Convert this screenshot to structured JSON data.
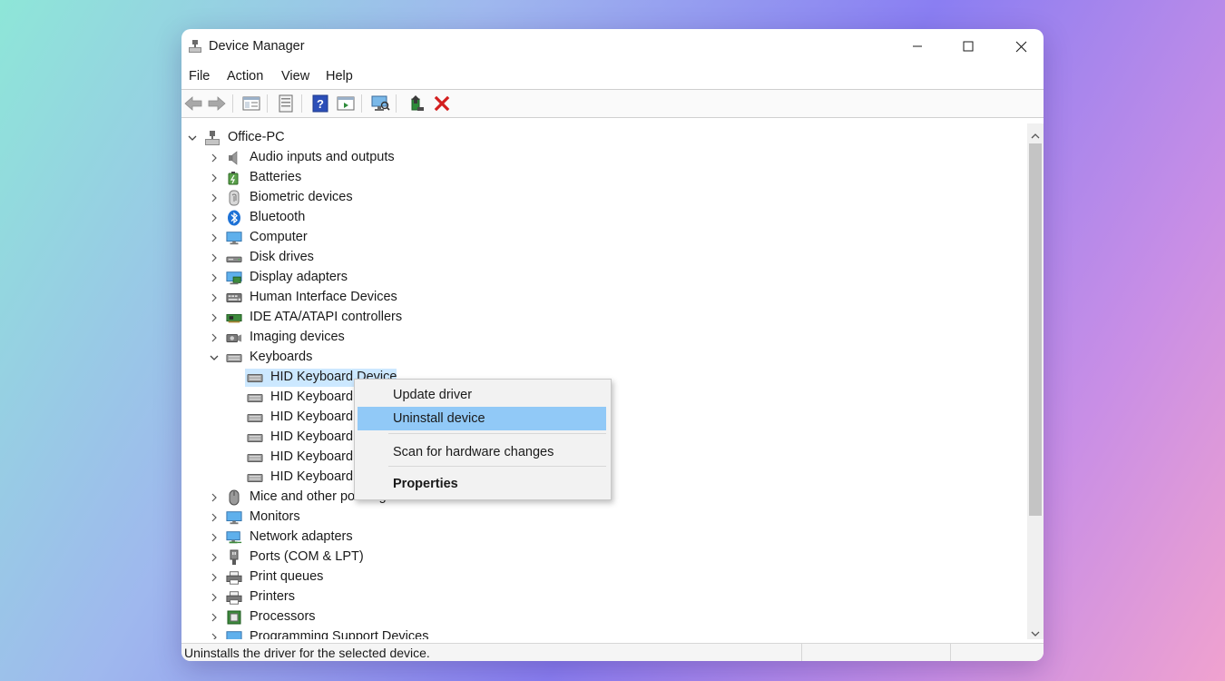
{
  "window": {
    "title": "Device Manager",
    "app_icon": "device-manager-icon"
  },
  "menubar": [
    "File",
    "Action",
    "View",
    "Help"
  ],
  "toolbar": {
    "icons": [
      "back-arrow-icon",
      "forward-arrow-icon",
      "show-hide-console-tree-icon",
      "properties-sheet-icon",
      "help-icon",
      "action-pane-icon",
      "scan-hardware-icon",
      "update-driver-icon",
      "uninstall-device-icon"
    ]
  },
  "tree": {
    "root": "Office-PC",
    "categories_top": [
      {
        "label": "Audio inputs and outputs",
        "icon": "speaker-icon"
      },
      {
        "label": "Batteries",
        "icon": "battery-icon"
      },
      {
        "label": "Biometric devices",
        "icon": "fingerprint-icon"
      },
      {
        "label": "Bluetooth",
        "icon": "bluetooth-icon"
      },
      {
        "label": "Computer",
        "icon": "monitor-icon"
      },
      {
        "label": "Disk drives",
        "icon": "disk-drive-icon"
      },
      {
        "label": "Display adapters",
        "icon": "display-adapter-icon"
      },
      {
        "label": "Human Interface Devices",
        "icon": "hid-icon"
      },
      {
        "label": "IDE ATA/ATAPI controllers",
        "icon": "ide-controller-icon"
      },
      {
        "label": "Imaging devices",
        "icon": "camera-icon"
      }
    ],
    "keyboards": {
      "label": "Keyboards",
      "children": [
        "HID Keyboard Device",
        "HID Keyboard",
        "HID Keyboard",
        "HID Keyboard",
        "HID Keyboard",
        "HID Keyboard"
      ]
    },
    "categories_bottom": [
      {
        "label": "Mice and other pointing devices",
        "icon": "mouse-icon"
      },
      {
        "label": "Monitors",
        "icon": "monitor-icon"
      },
      {
        "label": "Network adapters",
        "icon": "network-adapter-icon"
      },
      {
        "label": "Ports (COM & LPT)",
        "icon": "port-icon"
      },
      {
        "label": "Print queues",
        "icon": "printer-icon"
      },
      {
        "label": "Printers",
        "icon": "printer-icon"
      },
      {
        "label": "Processors",
        "icon": "processor-icon"
      },
      {
        "label": "Programming Support Devices",
        "icon": "programming-device-icon"
      }
    ]
  },
  "context_menu": {
    "items": [
      "Update driver",
      "Uninstall device",
      "Scan for hardware changes",
      "Properties"
    ],
    "highlighted": "Uninstall device"
  },
  "status": {
    "text": "Uninstalls the driver for the selected device."
  },
  "colors": {
    "selection": "#cce8ff",
    "menu_highlight": "#91c9f7",
    "uninstall_x": "#d31e1e"
  }
}
